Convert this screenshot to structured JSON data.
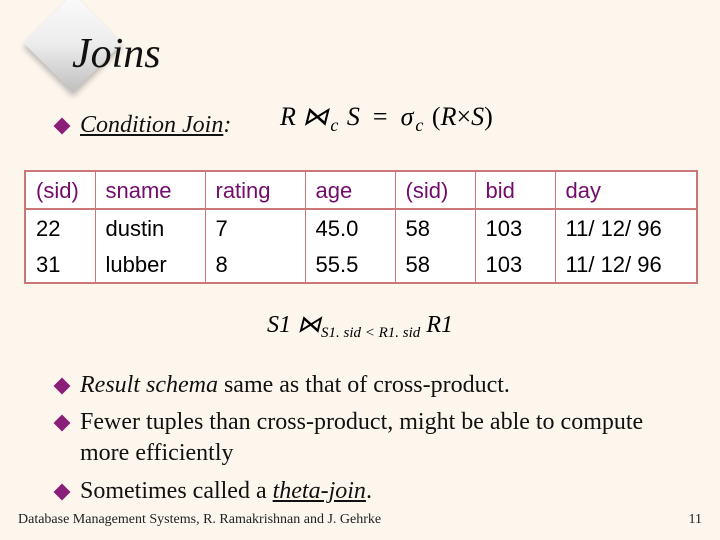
{
  "title": "Joins",
  "bullet_top": {
    "label": "Condition Join",
    "colon": ":"
  },
  "formula_top": {
    "R": "R",
    "join_sym": "⋈",
    "sub_c1": "c",
    "S": "S",
    "eq": "=",
    "sigma": "σ",
    "sub_c2": "c",
    "lparen": "(",
    "Rx": "R",
    "times": "×",
    "Sx": "S",
    "rparen": ")"
  },
  "table": {
    "headers": [
      "(sid)",
      "sname",
      "rating",
      "age",
      "(sid)",
      "bid",
      "day"
    ],
    "rows": [
      [
        "22",
        "dustin",
        "7",
        "45.0",
        "58",
        "103",
        "11/ 12/ 96"
      ],
      [
        "31",
        "lubber",
        "8",
        "55.5",
        "58",
        "103",
        "11/ 12/ 96"
      ]
    ]
  },
  "formula_mid": {
    "S1": "S1",
    "join_sym": "⋈",
    "cond": "S1. sid < R1. sid",
    "R1": "R1"
  },
  "bullets_bottom": [
    {
      "pre": "",
      "ital": "Result schema",
      "post": " same as that of cross-product."
    },
    {
      "pre": "",
      "ital": "",
      "post": "Fewer tuples than cross-product, might be able to compute more efficiently"
    },
    {
      "pre": "Sometimes called a ",
      "ital_underline": "theta-join",
      "post": "."
    }
  ],
  "footer": {
    "left": "Database Management Systems, R. Ramakrishnan and J. Gehrke",
    "right": "11"
  }
}
